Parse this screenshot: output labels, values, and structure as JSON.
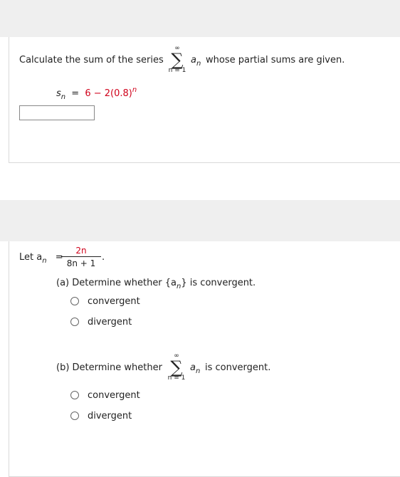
{
  "q1": {
    "prompt_before": "Calculate the sum of the series",
    "sigma_upper": "∞",
    "sigma_symbol": "∑",
    "sigma_lower": "n = 1",
    "term_var": "a",
    "term_sub": "n",
    "prompt_after": "whose partial sums are given.",
    "sn_var": "s",
    "sn_sub": "n",
    "sn_eq": "=",
    "sn_expr": "6 − 2(0.8)",
    "sn_exp": "n",
    "answer_value": ""
  },
  "q2": {
    "let_label": "Let a",
    "let_sub": "n",
    "let_eq": "=",
    "frac_num": "2n",
    "frac_den": "8n + 1",
    "frac_end": ".",
    "part_a_prefix": "(a) Determine whether {a",
    "part_a_sub": "n",
    "part_a_suffix": "} is convergent.",
    "part_a_options": [
      "convergent",
      "divergent"
    ],
    "part_b_prefix": "(b) Determine whether",
    "sigma_upper": "∞",
    "sigma_symbol": "∑",
    "sigma_lower": "n = 1",
    "term_var": "a",
    "term_sub": "n",
    "part_b_suffix": "is convergent.",
    "part_b_options": [
      "convergent",
      "divergent"
    ]
  },
  "colors": {
    "accent_red": "#d0021b",
    "band": "#efefef",
    "border": "#d9d9d9"
  }
}
